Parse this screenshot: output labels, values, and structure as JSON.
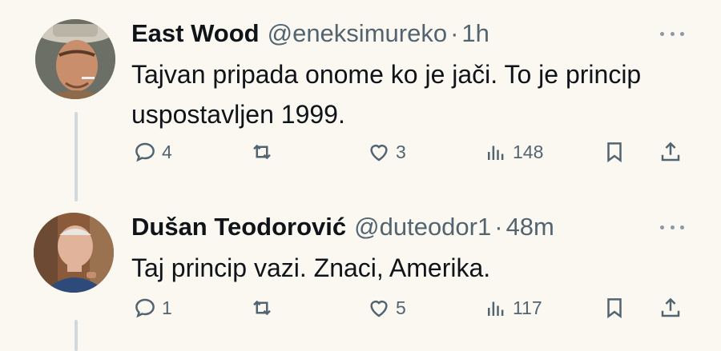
{
  "tweets": [
    {
      "display_name": "East Wood",
      "handle": "@eneksimureko",
      "separator": "·",
      "time": "1h",
      "text": "Tajvan pripada onome ko je jači. To je princip uspostavljen 1999.",
      "replies": "4",
      "reposts": "",
      "likes": "3",
      "views": "148",
      "avatar_icon": "avatar-man-hat-icon"
    },
    {
      "display_name": "Dušan Teodorović",
      "handle": "@duteodor1",
      "separator": "·",
      "time": "48m",
      "text": "Taj princip vazi. Znaci, Amerika.",
      "replies": "1",
      "reposts": "",
      "likes": "5",
      "views": "117",
      "avatar_icon": "avatar-man-glasses-icon"
    }
  ],
  "colors": {
    "background": "#fbf8f1",
    "text": "#0f1419",
    "muted": "#536471",
    "thread_line": "#cfd9de"
  }
}
